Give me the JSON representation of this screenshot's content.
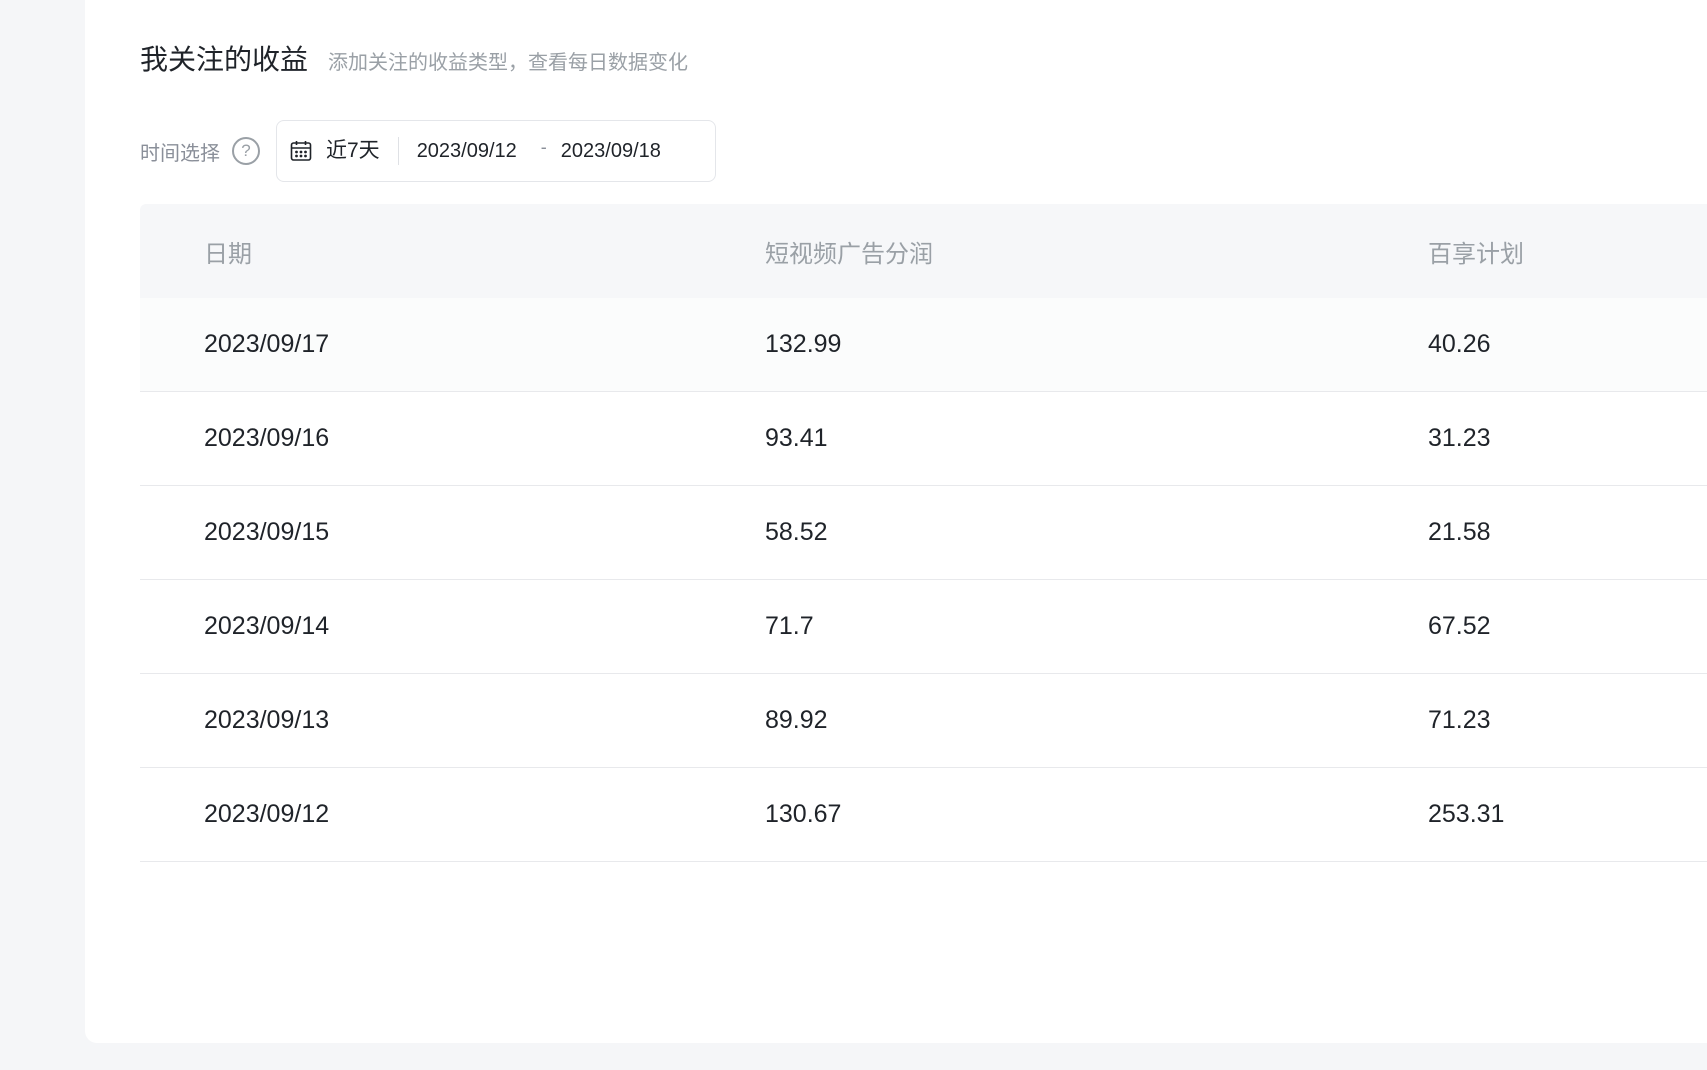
{
  "section": {
    "title": "我关注的收益",
    "subtitle": "添加关注的收益类型，查看每日数据变化"
  },
  "filter": {
    "label": "时间选择",
    "help_icon": "question-circle-icon",
    "calendar_icon": "calendar-icon",
    "preset": "近7天",
    "start_date": "2023/09/12",
    "separator": "-",
    "end_date": "2023/09/18"
  },
  "table": {
    "columns": [
      "日期",
      "短视频广告分润",
      "百享计划"
    ],
    "rows": [
      [
        "2023/09/17",
        "132.99",
        "40.26"
      ],
      [
        "2023/09/16",
        "93.41",
        "31.23"
      ],
      [
        "2023/09/15",
        "58.52",
        "21.58"
      ],
      [
        "2023/09/14",
        "71.7",
        "67.52"
      ],
      [
        "2023/09/13",
        "89.92",
        "71.23"
      ],
      [
        "2023/09/12",
        "130.67",
        "253.31"
      ]
    ]
  },
  "colors": {
    "background": "#f5f6f8",
    "card": "#ffffff",
    "header_bg": "#f6f7f9",
    "text_primary": "#1f2329",
    "text_secondary": "#9aa0a6"
  }
}
